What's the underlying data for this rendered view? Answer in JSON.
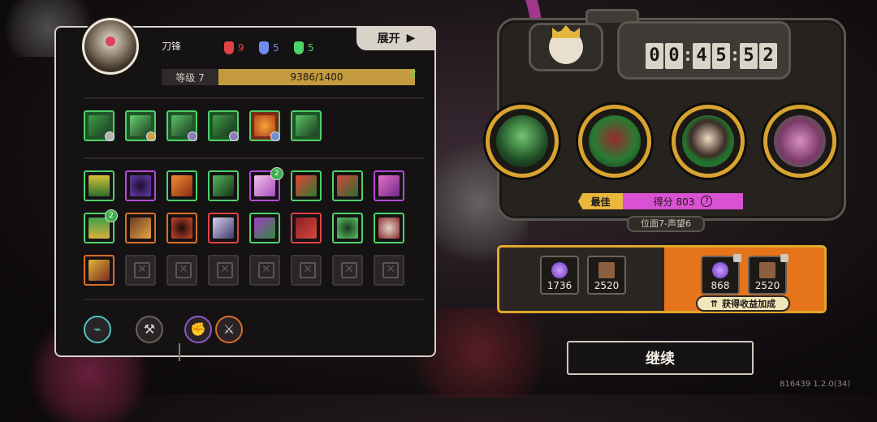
{
  "hero": {
    "name": "刀锋",
    "stats": [
      {
        "icon": "red-creature-icon",
        "value": "9",
        "color": "#e04245"
      },
      {
        "icon": "blue-creature-icon",
        "value": "5",
        "color": "#6d8df2"
      },
      {
        "icon": "green-creature-icon",
        "value": "5",
        "color": "#4ed26a"
      }
    ],
    "expand_label": "展开",
    "level_label": "等级 7",
    "xp_text": "9386/1400",
    "xp_fill_fraction": 1.0
  },
  "skills": {
    "row1_badges": [
      "",
      "",
      "",
      "",
      "",
      ""
    ],
    "row2_badges": [
      "",
      "",
      "",
      "",
      "",
      "2",
      "",
      ""
    ],
    "row3_badges": [
      "2",
      "",
      "",
      "",
      "",
      "",
      "",
      ""
    ]
  },
  "timer": {
    "digits": [
      "0",
      "0",
      "4",
      "5",
      "5",
      "2"
    ]
  },
  "score": {
    "best_label": "最佳",
    "score_text": "得分 803",
    "help": "?",
    "realm": "位面7-声望6"
  },
  "rewards": {
    "items": [
      "1736",
      "2520"
    ],
    "bonus_items": [
      "868",
      "2520"
    ],
    "gain_label": "获得收益加成"
  },
  "continue_label": "继续",
  "version": "816439 1.2.0(34)"
}
